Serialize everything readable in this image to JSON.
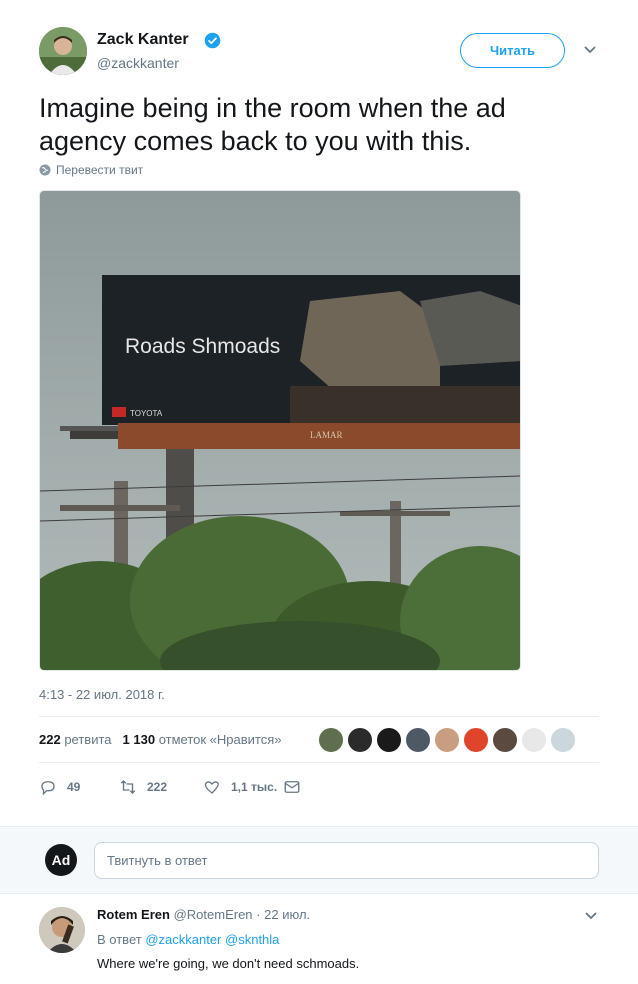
{
  "tweet": {
    "author_name": "Zack Kanter",
    "author_handle": "@zackkanter",
    "follow_label": "Читать",
    "text": "Imagine being in the room when the ad agency comes back to you with this.",
    "translate_label": "Перевести твит",
    "timestamp": "4:13 - 22 июл. 2018 г.",
    "photo": {
      "billboard_text": "Roads Shmoads",
      "brand_text": "TOYOTA",
      "lamar_text": "LAMAR"
    },
    "stats": {
      "retweets_count": "222",
      "retweets_label": "ретвита",
      "likes_count": "1 130",
      "likes_label": "отметок «Нравится»"
    },
    "actions": {
      "replies": "49",
      "retweets": "222",
      "likes": "1,1 тыс."
    }
  },
  "reply_box": {
    "avatar_text": "Ad",
    "placeholder": "Твитнуть в ответ"
  },
  "reply": {
    "author_name": "Rotem Eren",
    "author_handle": "@RotemEren",
    "separator": "·",
    "date": "22 июл.",
    "in_reply_label": "В ответ",
    "mention_1": "@zackkanter",
    "mention_2": "@sknthla",
    "text": "Where we're going, we don't need schmoads."
  },
  "colors": {
    "accent": "#1da1f2",
    "text_primary": "#14171a",
    "text_secondary": "#657786",
    "border": "#e6ecf0"
  }
}
